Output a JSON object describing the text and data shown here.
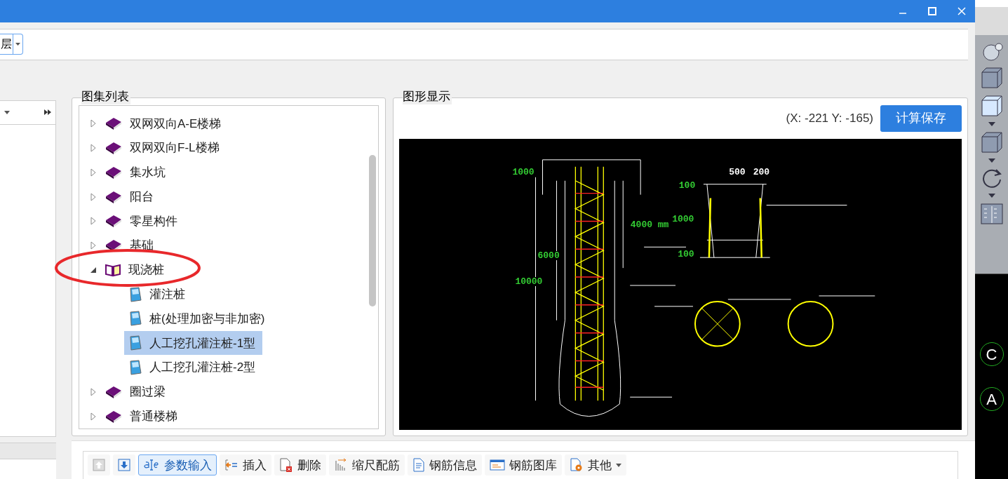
{
  "layer_combo": {
    "value": "层"
  },
  "atlas_list": {
    "title": "图集列表",
    "items": [
      {
        "label": "双网双向A-E楼梯",
        "kind": "book",
        "expanded": false
      },
      {
        "label": "双网双向F-L楼梯",
        "kind": "book",
        "expanded": false
      },
      {
        "label": "集水坑",
        "kind": "book",
        "expanded": false
      },
      {
        "label": "阳台",
        "kind": "book",
        "expanded": false
      },
      {
        "label": "零星构件",
        "kind": "book",
        "expanded": false
      },
      {
        "label": "基础",
        "kind": "book",
        "expanded": false
      },
      {
        "label": "现浇桩",
        "kind": "book",
        "expanded": true,
        "children": [
          {
            "label": "灌注桩",
            "kind": "page",
            "selected": false
          },
          {
            "label": "桩(处理加密与非加密)",
            "kind": "page",
            "selected": false
          },
          {
            "label": "人工挖孔灌注桩-1型",
            "kind": "page",
            "selected": true
          },
          {
            "label": "人工挖孔灌注桩-2型",
            "kind": "page",
            "selected": false
          }
        ]
      },
      {
        "label": "圈过梁",
        "kind": "book",
        "expanded": false
      },
      {
        "label": "普通楼梯",
        "kind": "book",
        "expanded": false
      }
    ]
  },
  "graphic_display": {
    "title": "图形显示",
    "coordinates": "(X: -221 Y: -165)",
    "save_button": "计算保存",
    "drawing_labels": [
      {
        "text": "1000",
        "color": "#33cc33"
      },
      {
        "text": "500",
        "color": "#ffffff"
      },
      {
        "text": "200",
        "color": "#ffffff"
      },
      {
        "text": "100",
        "color": "#33cc33"
      },
      {
        "text": "1000",
        "color": "#33cc33"
      },
      {
        "text": "100",
        "color": "#33cc33"
      },
      {
        "text": "4000 mm",
        "color": "#33cc33"
      },
      {
        "text": "6000",
        "color": "#33cc33"
      },
      {
        "text": "10000",
        "color": "#33cc33"
      }
    ]
  },
  "toolbar": [
    {
      "kind": "up",
      "active": false
    },
    {
      "kind": "down",
      "active": false
    },
    {
      "kind": "param",
      "label": "参数输入",
      "active": true
    },
    {
      "kind": "insert",
      "label": "插入",
      "active": false
    },
    {
      "kind": "delete",
      "label": "删除",
      "active": false
    },
    {
      "kind": "scale",
      "label": "缩尺配筋",
      "active": false
    },
    {
      "kind": "info",
      "label": "钢筋信息",
      "active": false
    },
    {
      "kind": "library",
      "label": "钢筋图库",
      "active": false
    },
    {
      "kind": "other",
      "label": "其他",
      "active": false
    }
  ],
  "cad_strip": {
    "labels": [
      "C",
      "A"
    ]
  }
}
